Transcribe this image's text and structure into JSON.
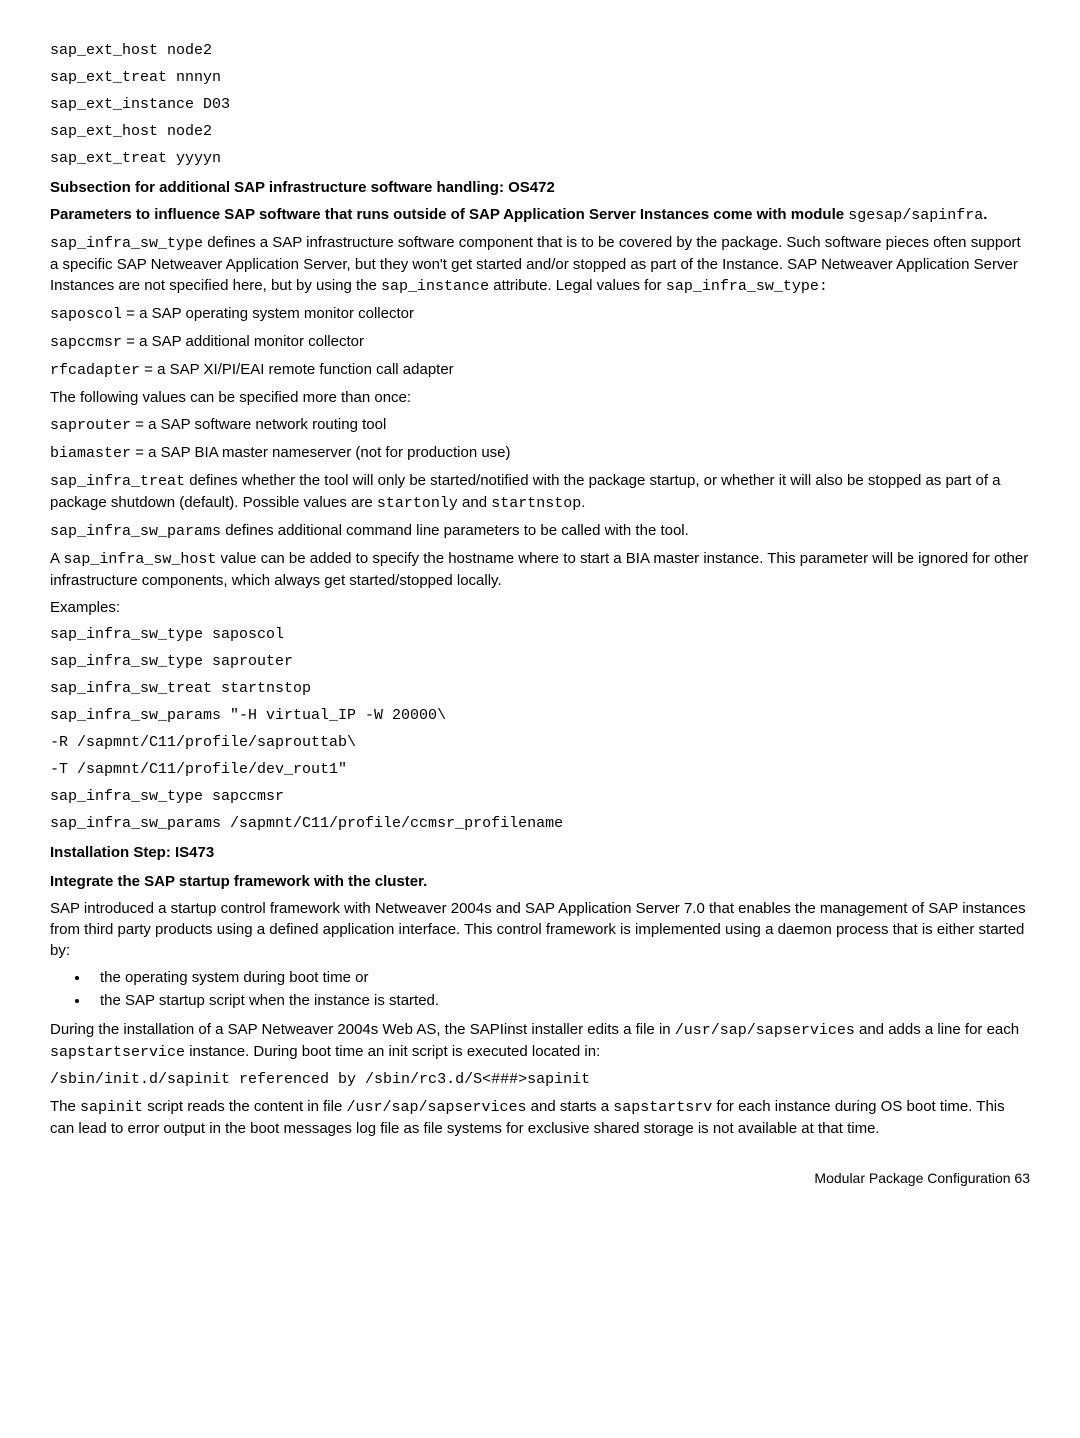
{
  "block1": {
    "l1": "sap_ext_host node2",
    "l2": "sap_ext_treat nnnyn",
    "l3": "sap_ext_instance D03",
    "l4": "sap_ext_host node2",
    "l5": "sap_ext_treat yyyyn"
  },
  "h1": "Subsection for additional SAP infrastructure software handling: OS472",
  "p1a": "Parameters to influence SAP software that runs outside of SAP Application Server Instances come with module ",
  "p1b": "sgesap/sapinfra",
  "p1c": ".",
  "p2a": "sap_infra_sw_type",
  "p2b": " defines a SAP infrastructure software component that is to be covered by the package. Such software pieces often support a specific SAP Netweaver Application Server, but they won't get started and/or stopped as part of the Instance. SAP Netweaver Application Server Instances are not specified here, but by using the ",
  "p2c": "sap_instance",
  "p2d": " attribute. Legal values for ",
  "p2e": "sap_infra_sw_type:",
  "p3a": "saposcol",
  "p3b": " = a SAP operating system monitor collector",
  "p4a": "sapccmsr",
  "p4b": " = a SAP additional monitor collector",
  "p5a": "rfcadapter",
  "p5b": " = a SAP XI/PI/EAI remote function call adapter",
  "p6": "The following values can be specified more than once:",
  "p7a": "saprouter",
  "p7b": " = a SAP software network routing tool",
  "p8a": "biamaster",
  "p8b": " = a SAP BIA master nameserver (not for production use)",
  "p9a": "sap_infra_treat",
  "p9b": " defines whether the tool will only be started/notified with the package startup, or whether it will also be stopped as part of a package shutdown (default). Possible values are ",
  "p9c": "startonly",
  "p9d": " and ",
  "p9e": "startnstop",
  "p9f": ".",
  "p10a": "sap_infra_sw_params",
  "p10b": " defines additional command line parameters to be called with the tool.",
  "p11a": "A ",
  "p11b": "sap_infra_sw_host",
  "p11c": " value can be added to specify the hostname where to start a BIA master instance. This parameter will be ignored for other infrastructure components, which always get started/stopped locally.",
  "p12": "Examples:",
  "block2": {
    "l1": "sap_infra_sw_type saposcol",
    "l2": "sap_infra_sw_type saprouter",
    "l3": "sap_infra_sw_treat startnstop",
    "l4": "sap_infra_sw_params \"-H virtual_IP -W 20000\\",
    "l5": "-R /sapmnt/C11/profile/saprouttab\\",
    "l6": "-T /sapmnt/C11/profile/dev_rout1\"",
    "l7": "sap_infra_sw_type sapccmsr",
    "l8": "sap_infra_sw_params /sapmnt/C11/profile/ccmsr_profilename"
  },
  "h2": "Installation Step: IS473",
  "h3": "Integrate the SAP startup framework with the cluster.",
  "p13": "SAP introduced a startup control framework with Netweaver 2004s and SAP Application Server 7.0 that enables the management of SAP instances from third party products using a defined application interface. This control framework is implemented using a daemon process that is either started by:",
  "li1": "the operating system during boot time or",
  "li2": "the SAP startup script when the instance is started.",
  "p14a": "During the installation of a SAP Netweaver 2004s Web AS, the SAPIinst installer edits a file in ",
  "p14b": "/usr/sap/sapservices",
  "p14c": " and adds a line for each ",
  "p14d": "sapstartservice",
  "p14e": " instance. During boot time an init script is executed located in:",
  "p15": "/sbin/init.d/sapinit referenced by /sbin/rc3.d/S<###>sapinit",
  "p16a": "The ",
  "p16b": "sapinit",
  "p16c": " script reads the content in file ",
  "p16d": "/usr/sap/sapservices",
  "p16e": " and starts a ",
  "p16f": "sapstartsrv",
  "p16g": " for each instance during OS boot time. This can lead to error output in the boot messages log file as file systems for exclusive shared storage is not available at that time.",
  "footer": "Modular Package Configuration    63"
}
